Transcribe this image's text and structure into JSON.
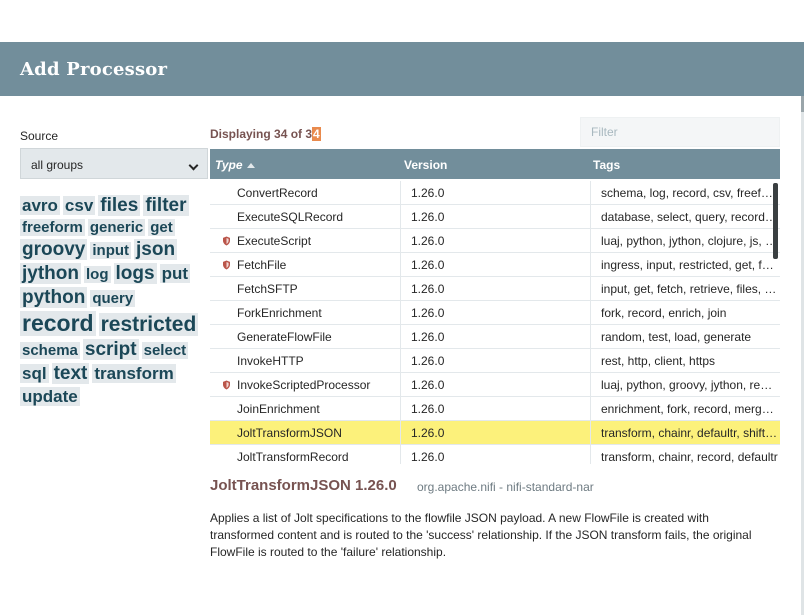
{
  "dialog": {
    "title": "Add Processor"
  },
  "source": {
    "label": "Source",
    "value": "all groups"
  },
  "tag_cloud": [
    {
      "label": "avro",
      "size": 17
    },
    {
      "label": "csv",
      "size": 17
    },
    {
      "label": "files",
      "size": 19
    },
    {
      "label": "filter",
      "size": 19
    },
    {
      "label": "freeform",
      "size": 15
    },
    {
      "label": "generic",
      "size": 15
    },
    {
      "label": "get",
      "size": 15
    },
    {
      "label": "groovy",
      "size": 19
    },
    {
      "label": "input",
      "size": 15
    },
    {
      "label": "json",
      "size": 19
    },
    {
      "label": "jython",
      "size": 19
    },
    {
      "label": "log",
      "size": 15
    },
    {
      "label": "logs",
      "size": 19
    },
    {
      "label": "put",
      "size": 17
    },
    {
      "label": "python",
      "size": 19
    },
    {
      "label": "query",
      "size": 15
    },
    {
      "label": "record",
      "size": 23
    },
    {
      "label": "restricted",
      "size": 21
    },
    {
      "label": "schema",
      "size": 15
    },
    {
      "label": "script",
      "size": 19
    },
    {
      "label": "select",
      "size": 15
    },
    {
      "label": "sql",
      "size": 17
    },
    {
      "label": "text",
      "size": 19
    },
    {
      "label": "transform",
      "size": 17
    },
    {
      "label": "update",
      "size": 17
    }
  ],
  "displaying": {
    "prefix": "Displaying 34 of 3",
    "highlight": "4"
  },
  "filter": {
    "placeholder": "Filter",
    "value": ""
  },
  "grid": {
    "columns": {
      "type": "Type",
      "version": "Version",
      "tags": "Tags"
    },
    "rows": [
      {
        "type": "ConvertRecord",
        "version": "1.26.0",
        "tags": "schema, log, record, csv, freeform, generic",
        "restricted": false,
        "selected": false
      },
      {
        "type": "ExecuteSQLRecord",
        "version": "1.26.0",
        "tags": "database, select, query, record, jdbc, sql",
        "restricted": false,
        "selected": false
      },
      {
        "type": "ExecuteScript",
        "version": "1.26.0",
        "tags": "luaj, python, jython, clojure, js, execute",
        "restricted": true,
        "selected": false
      },
      {
        "type": "FetchFile",
        "version": "1.26.0",
        "tags": "ingress, input, restricted, get, fetch, files",
        "restricted": true,
        "selected": false
      },
      {
        "type": "FetchSFTP",
        "version": "1.26.0",
        "tags": "input, get, fetch, retrieve, files, sftp",
        "restricted": false,
        "selected": false
      },
      {
        "type": "ForkEnrichment",
        "version": "1.26.0",
        "tags": "fork, record, enrich, join",
        "restricted": false,
        "selected": false
      },
      {
        "type": "GenerateFlowFile",
        "version": "1.26.0",
        "tags": "random, test, load, generate",
        "restricted": false,
        "selected": false
      },
      {
        "type": "InvokeHTTP",
        "version": "1.26.0",
        "tags": "rest, http, client, https",
        "restricted": false,
        "selected": false
      },
      {
        "type": "InvokeScriptedProcessor",
        "version": "1.26.0",
        "tags": "luaj, python, groovy, jython, restricted",
        "restricted": true,
        "selected": false
      },
      {
        "type": "JoinEnrichment",
        "version": "1.26.0",
        "tags": "enrichment, fork, record, merge, join",
        "restricted": false,
        "selected": false
      },
      {
        "type": "JoltTransformJSON",
        "version": "1.26.0",
        "tags": "transform, chainr, defaultr, shiftr, json",
        "restricted": false,
        "selected": true
      },
      {
        "type": "JoltTransformRecord",
        "version": "1.26.0",
        "tags": "transform, chainr, record, defaultr",
        "restricted": false,
        "selected": false
      }
    ]
  },
  "details": {
    "title": "JoltTransformJSON 1.26.0",
    "bundle": "org.apache.nifi - nifi-standard-nar",
    "description": "Applies a list of Jolt specifications to the flowfile JSON payload. A new FlowFile is created with transformed content and is routed to the 'success' relationship. If the JSON transform fails, the original FlowFile is routed to the 'failure' relationship."
  },
  "colors": {
    "header_bg": "#728e9b",
    "selected_row": "#fcf17b",
    "accent_text": "#775351",
    "tag_text": "#1b4757",
    "restricted_icon": "#ba554a",
    "highlight_bg": "#e98a4d"
  },
  "icons": {
    "restricted": "shield-icon",
    "sort": "sort-ascending-icon",
    "dropdown": "chevron-down-icon"
  }
}
